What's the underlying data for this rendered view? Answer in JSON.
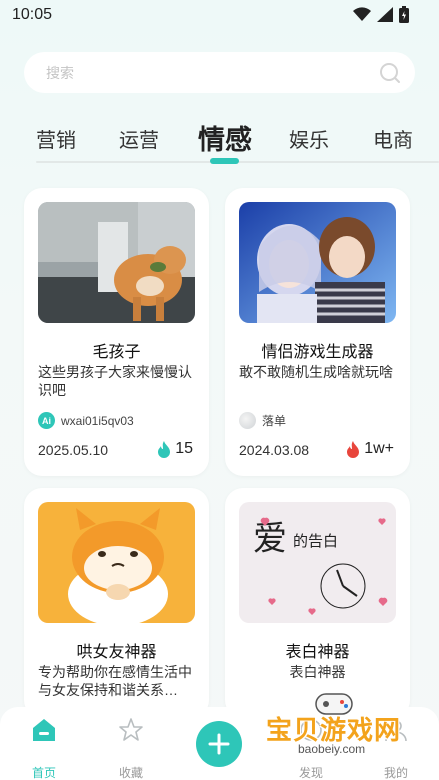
{
  "status": {
    "time": "10:05"
  },
  "search": {
    "placeholder": "搜索"
  },
  "tabs": [
    {
      "label": "营销",
      "active": false
    },
    {
      "label": "运营",
      "active": false
    },
    {
      "label": "情感",
      "active": true
    },
    {
      "label": "娱乐",
      "active": false
    },
    {
      "label": "电商",
      "active": false
    }
  ],
  "cards": [
    {
      "title": "毛孩子",
      "desc": "这些男孩子大家来慢慢认识吧",
      "author": "wxai01i5qv03",
      "date": "2025.05.10",
      "hot": "15"
    },
    {
      "title": "情侣游戏生成器",
      "desc": "敢不敢随机生成啥就玩啥",
      "author": "落单",
      "date": "2024.03.08",
      "hot": "1w+"
    },
    {
      "title": "哄女友神器",
      "desc": "专为帮助你在感情生活中与女友保持和谐关系…",
      "author": "",
      "date": "",
      "hot": ""
    },
    {
      "title": "表白神器",
      "desc": "表白神器",
      "author": "",
      "date": "",
      "hot": ""
    }
  ],
  "card_images": {
    "card4_text_big": "爱",
    "card4_text_small": "的告白"
  },
  "nav": {
    "home": "首页",
    "favorites": "收藏",
    "discover": "发现",
    "mine": "我的"
  },
  "watermark": {
    "title": "宝贝游戏网",
    "url": "baobeiy.com"
  },
  "colors": {
    "accent": "#2ec6b8",
    "hot": "#e8453c",
    "watermark": "#f3a31c"
  }
}
